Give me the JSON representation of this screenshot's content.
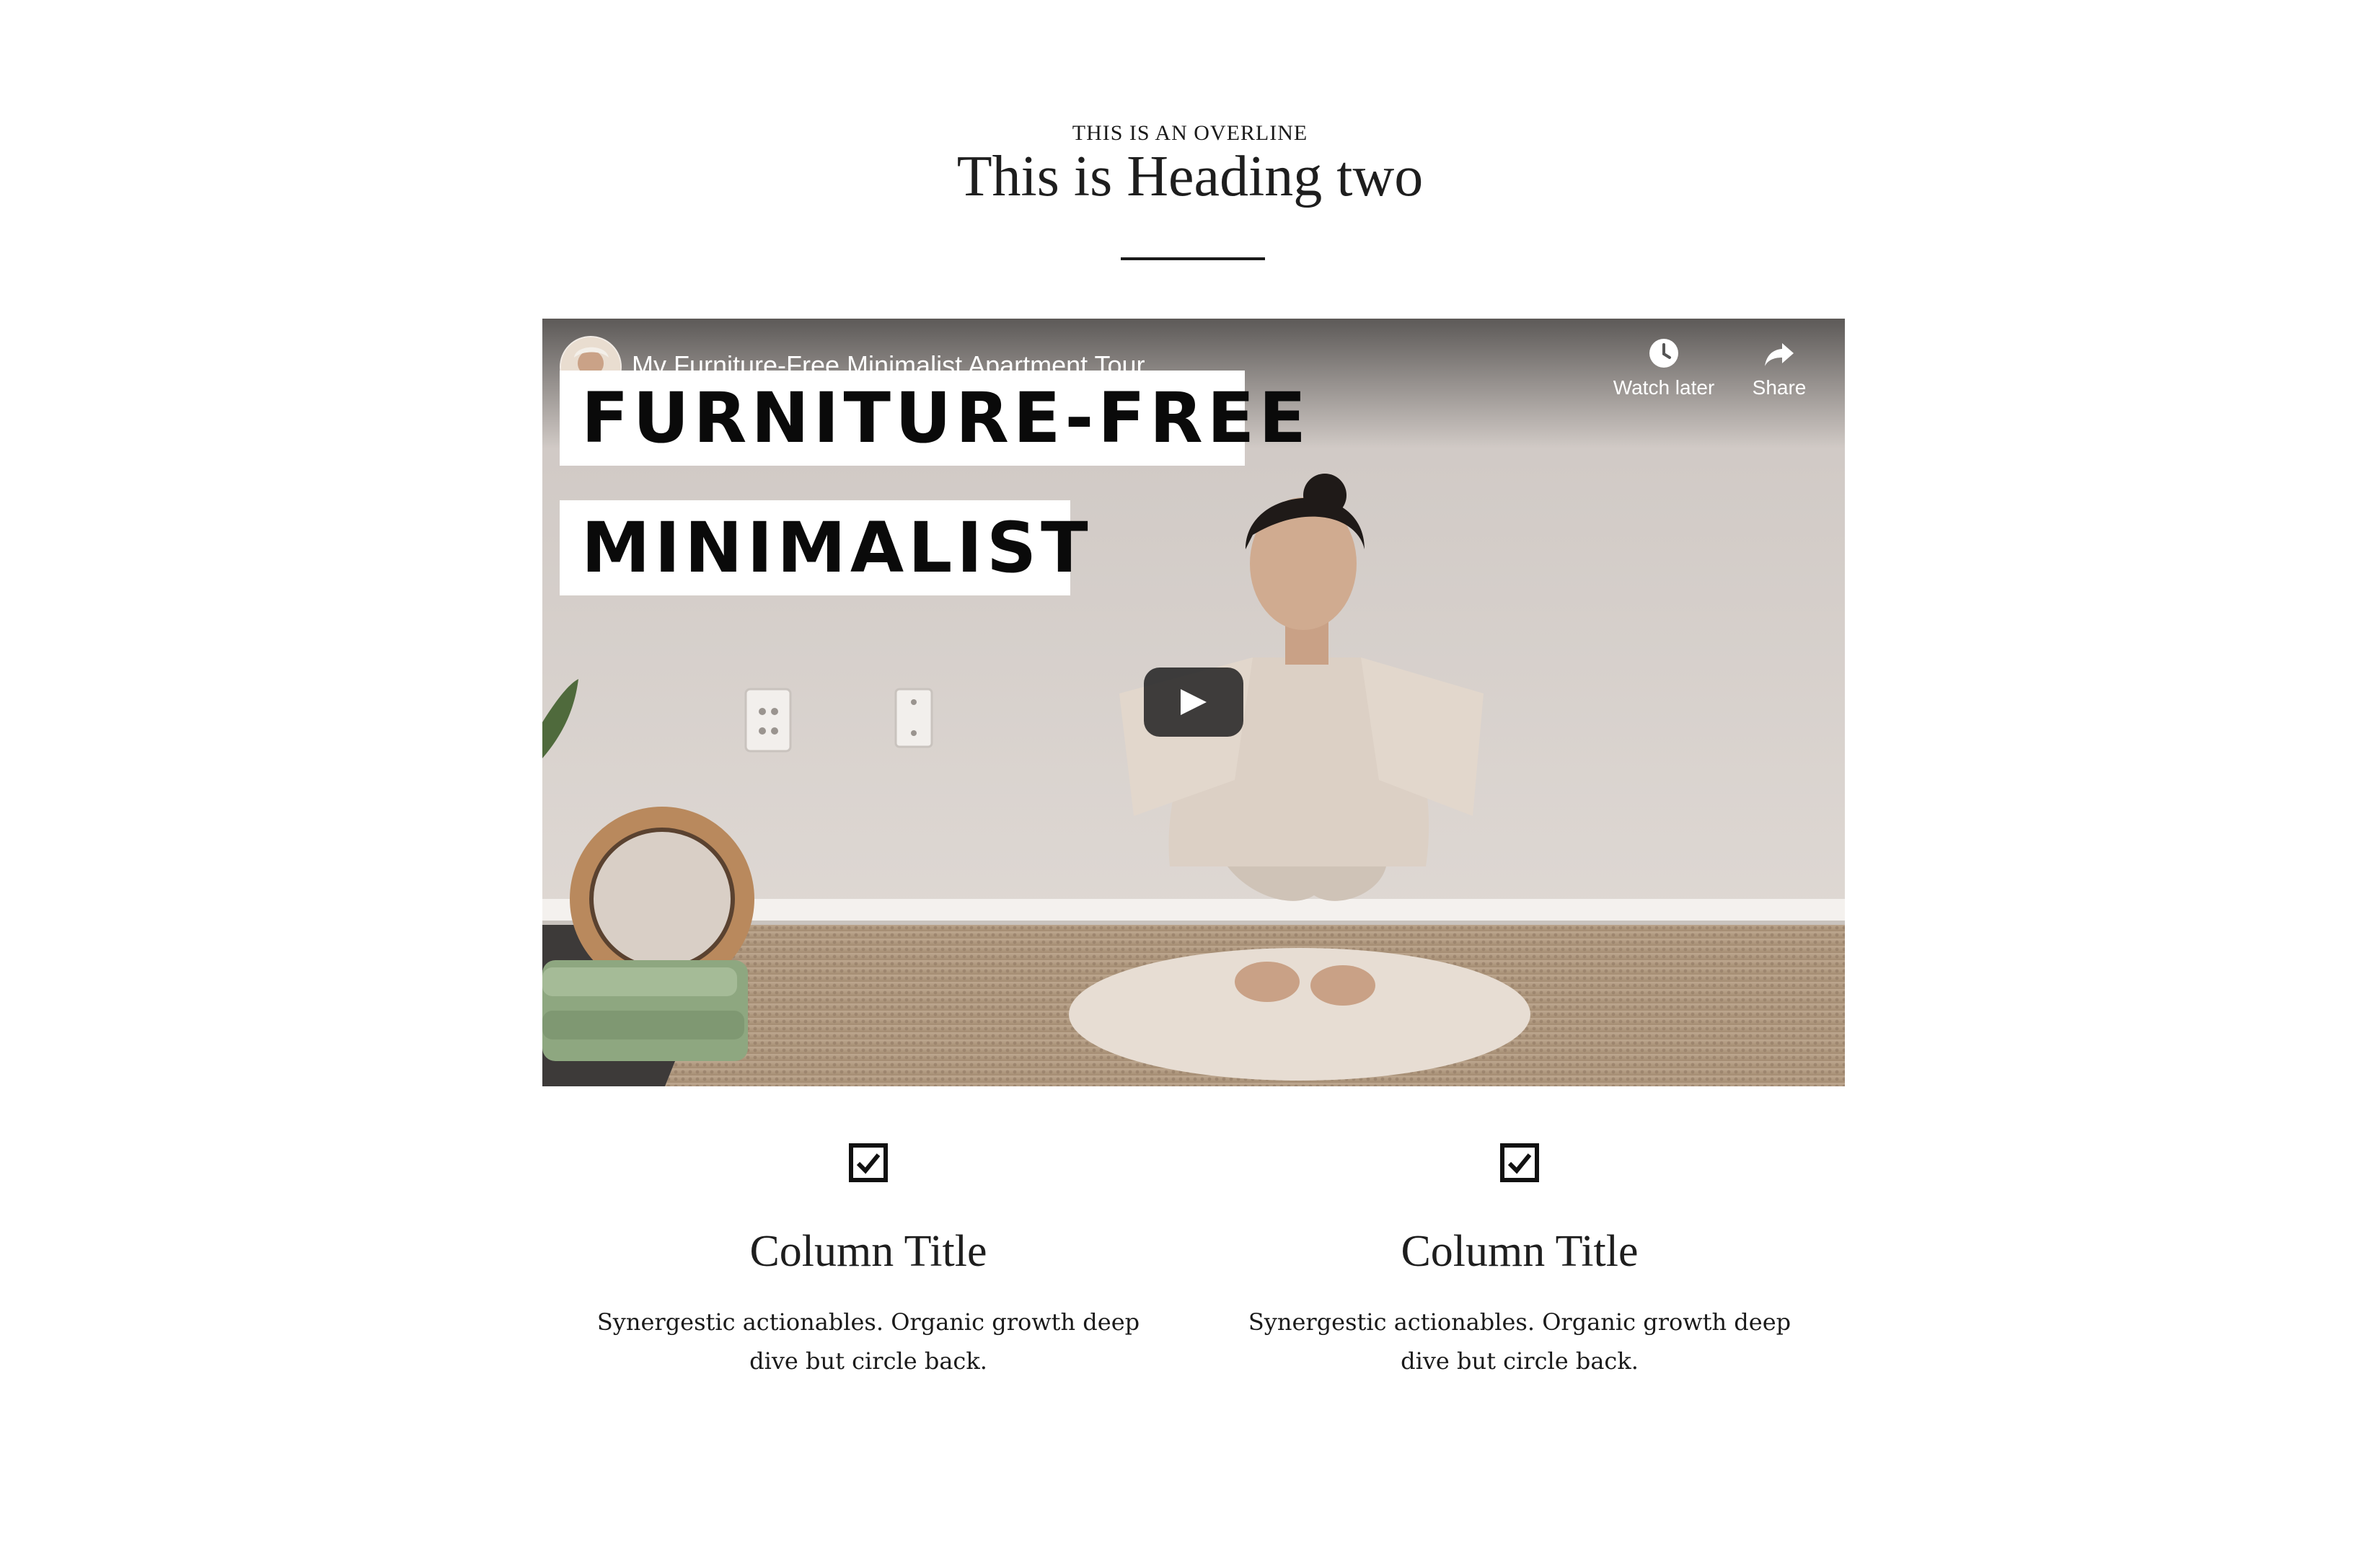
{
  "section": {
    "overline": "THIS IS AN OVERLINE",
    "heading": "This is Heading two"
  },
  "video": {
    "title": "My Furniture-Free Minimalist Apartment Tour",
    "overlay_lines": [
      "FURNITURE-FREE",
      "MINIMALIST"
    ],
    "controls": {
      "watch_later_label": "Watch later",
      "share_label": "Share"
    },
    "icons": {
      "play": "play-icon",
      "watch_later": "clock-icon",
      "share": "share-arrow-icon"
    }
  },
  "columns": [
    {
      "icon": "checkbox-checked-icon",
      "title": "Column Title",
      "text": "Synergestic actionables. Organic growth deep dive but circle back."
    },
    {
      "icon": "checkbox-checked-icon",
      "title": "Column Title",
      "text": "Synergestic actionables. Organic growth deep dive but circle back."
    }
  ],
  "colors": {
    "text": "#1e1e1e",
    "background": "#ffffff",
    "video_control_bg": "#212121"
  }
}
